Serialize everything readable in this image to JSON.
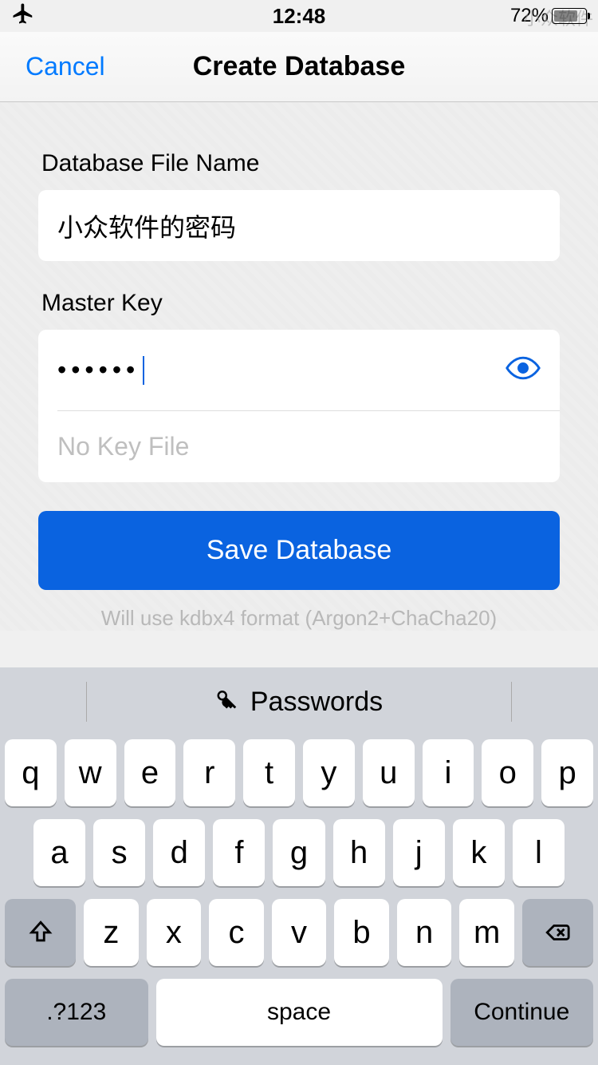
{
  "status": {
    "time": "12:48",
    "battery_pct": "72%"
  },
  "nav": {
    "cancel": "Cancel",
    "title": "Create Database"
  },
  "form": {
    "filename_label": "Database File Name",
    "filename_value": "小众软件的密码",
    "masterkey_label": "Master Key",
    "masterkey_value": "••••••",
    "keyfile_placeholder": "No Key File",
    "save_label": "Save Database",
    "hint": "Will use kdbx4 format (Argon2+ChaCha20)"
  },
  "keyboard": {
    "suggestion": "Passwords",
    "rows": [
      [
        "q",
        "w",
        "e",
        "r",
        "t",
        "y",
        "u",
        "i",
        "o",
        "p"
      ],
      [
        "a",
        "s",
        "d",
        "f",
        "g",
        "h",
        "j",
        "k",
        "l"
      ],
      [
        "z",
        "x",
        "c",
        "v",
        "b",
        "n",
        "m"
      ]
    ],
    "symbols_key": ".?123",
    "space_key": "space",
    "return_key": "Continue"
  },
  "watermark": "小众软件"
}
